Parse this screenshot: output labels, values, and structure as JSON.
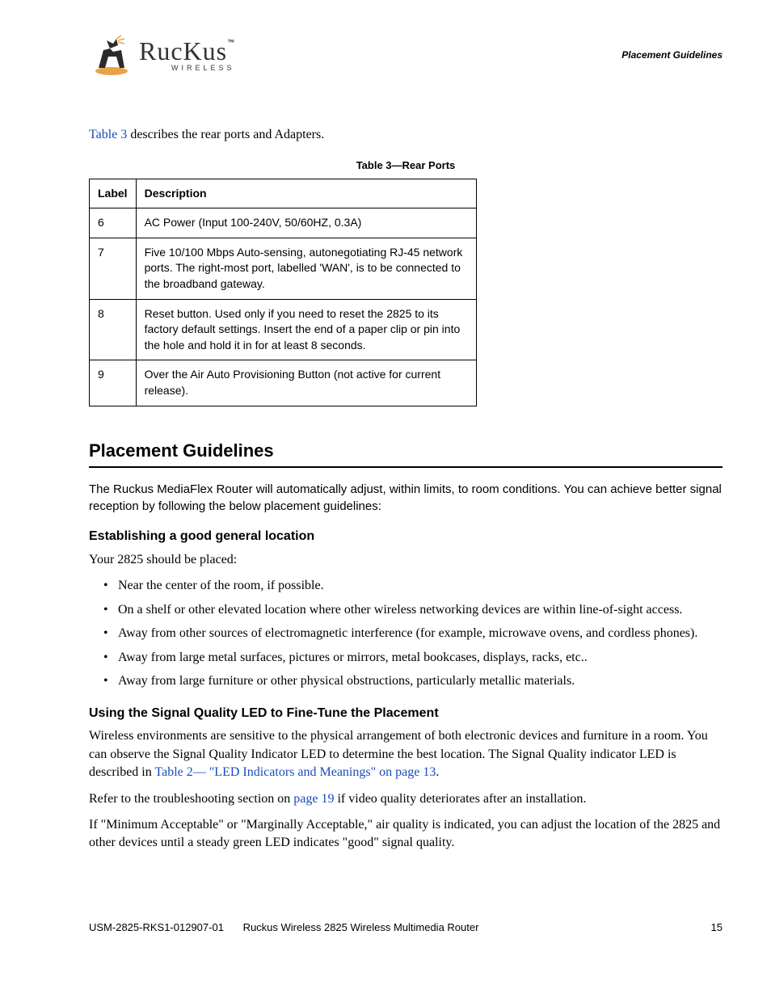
{
  "header": {
    "logo_word": "RucKus",
    "logo_sub": "WIRELESS",
    "tm": "™",
    "right_label": "Placement Guidelines"
  },
  "intro": {
    "link_text": "Table 3",
    "rest": " describes the rear ports and Adapters."
  },
  "table": {
    "caption": "Table 3—Rear Ports",
    "headers": {
      "label": "Label",
      "description": "Description"
    },
    "rows": [
      {
        "label": "6",
        "desc": "AC Power (Input 100-240V, 50/60HZ, 0.3A)"
      },
      {
        "label": "7",
        "desc": "Five 10/100 Mbps Auto-sensing, autonegotiating RJ-45 network ports. The right-most port, labelled 'WAN', is to be connected to the broadband gateway."
      },
      {
        "label": "8",
        "desc": "Reset button. Used only if you need to reset the 2825 to its factory default settings. Insert the end of a paper clip or pin into the hole and hold it in for at least 8 seconds."
      },
      {
        "label": "9",
        "desc": "Over the Air Auto Provisioning Button (not active for current release)."
      }
    ]
  },
  "section_title": "Placement Guidelines",
  "section_intro": "The Ruckus MediaFlex Router will automatically adjust, within limits, to room conditions. You can achieve better signal reception by following the below placement guidelines:",
  "sub1": {
    "title": "Establishing a good general location",
    "lead": "Your 2825 should be placed:",
    "items": [
      "Near the center of the room, if possible.",
      "On a shelf or other elevated location where other wireless networking devices are within line-of-sight access.",
      "Away from other sources of electromagnetic interference (for example, microwave ovens, and cordless phones).",
      "Away from large metal surfaces, pictures or mirrors, metal bookcases, displays, racks, etc..",
      "Away from large furniture or other physical obstructions, particularly metallic materials."
    ]
  },
  "sub2": {
    "title": "Using the Signal Quality LED to Fine-Tune the Placement",
    "p1_a": "Wireless environments are sensitive to the physical arrangement of both electronic devices and furniture in a room. You can observe the Signal Quality Indicator LED to determine the best location. The Signal Quality indicator LED is described in ",
    "p1_link": "Table 2— \"LED Indicators and Meanings\" on page 13",
    "p1_b": ".",
    "p2_a": "Refer to the troubleshooting section on ",
    "p2_link": "page 19",
    "p2_b": " if video quality deteriorates after an installation.",
    "p3": "If \"Minimum Acceptable\" or \"Marginally Acceptable,\" air quality is indicated, you can adjust the location of the 2825 and other devices until a steady green LED indicates \"good\" signal quality."
  },
  "footer": {
    "doc_id": "USM-2825-RKS1-012907-01",
    "doc_title": "Ruckus Wireless 2825 Wireless Multimedia Router",
    "page": "15"
  }
}
